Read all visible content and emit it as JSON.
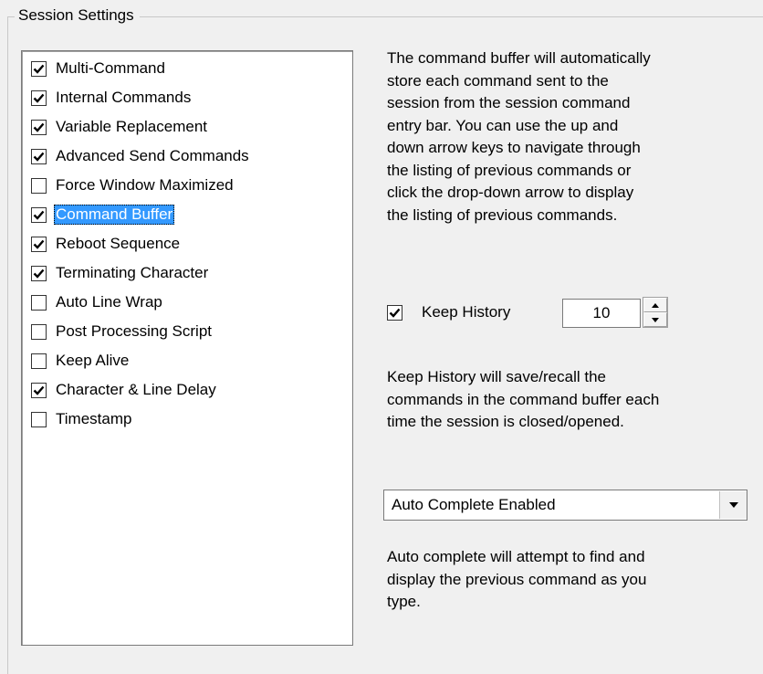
{
  "group": {
    "title": "Session Settings"
  },
  "options": [
    {
      "label": "Multi-Command",
      "checked": true,
      "selected": false
    },
    {
      "label": "Internal Commands",
      "checked": true,
      "selected": false
    },
    {
      "label": "Variable Replacement",
      "checked": true,
      "selected": false
    },
    {
      "label": "Advanced Send Commands",
      "checked": true,
      "selected": false
    },
    {
      "label": "Force Window Maximized",
      "checked": false,
      "selected": false
    },
    {
      "label": "Command Buffer",
      "checked": true,
      "selected": true
    },
    {
      "label": "Reboot Sequence",
      "checked": true,
      "selected": false
    },
    {
      "label": "Terminating Character",
      "checked": true,
      "selected": false
    },
    {
      "label": "Auto Line Wrap",
      "checked": false,
      "selected": false
    },
    {
      "label": "Post Processing Script",
      "checked": false,
      "selected": false
    },
    {
      "label": "Keep Alive",
      "checked": false,
      "selected": false
    },
    {
      "label": "Character & Line Delay",
      "checked": true,
      "selected": false
    },
    {
      "label": "Timestamp",
      "checked": false,
      "selected": false
    }
  ],
  "buffer": {
    "description_lines": [
      "The command buffer will automatically",
      "store each command sent to the",
      "session from the session command",
      "entry bar.  You can use the up and",
      "down arrow keys to navigate through",
      "the listing of previous commands or",
      "click the drop-down arrow to display",
      "the listing of previous commands."
    ]
  },
  "history": {
    "label": "Keep History",
    "checked": true,
    "value": "10",
    "description_lines": [
      "Keep History will save/recall the",
      "commands in the command buffer each",
      "time the session is closed/opened."
    ]
  },
  "autocomplete": {
    "selected": "Auto Complete Enabled",
    "description_lines": [
      "Auto complete will attempt to find and",
      "display the previous command as you",
      "type."
    ]
  },
  "icons": {
    "check": "checkmark-icon",
    "spin_up": "spin-up-arrow-icon",
    "spin_down": "spin-down-arrow-icon",
    "dropdown": "dropdown-arrow-icon"
  }
}
